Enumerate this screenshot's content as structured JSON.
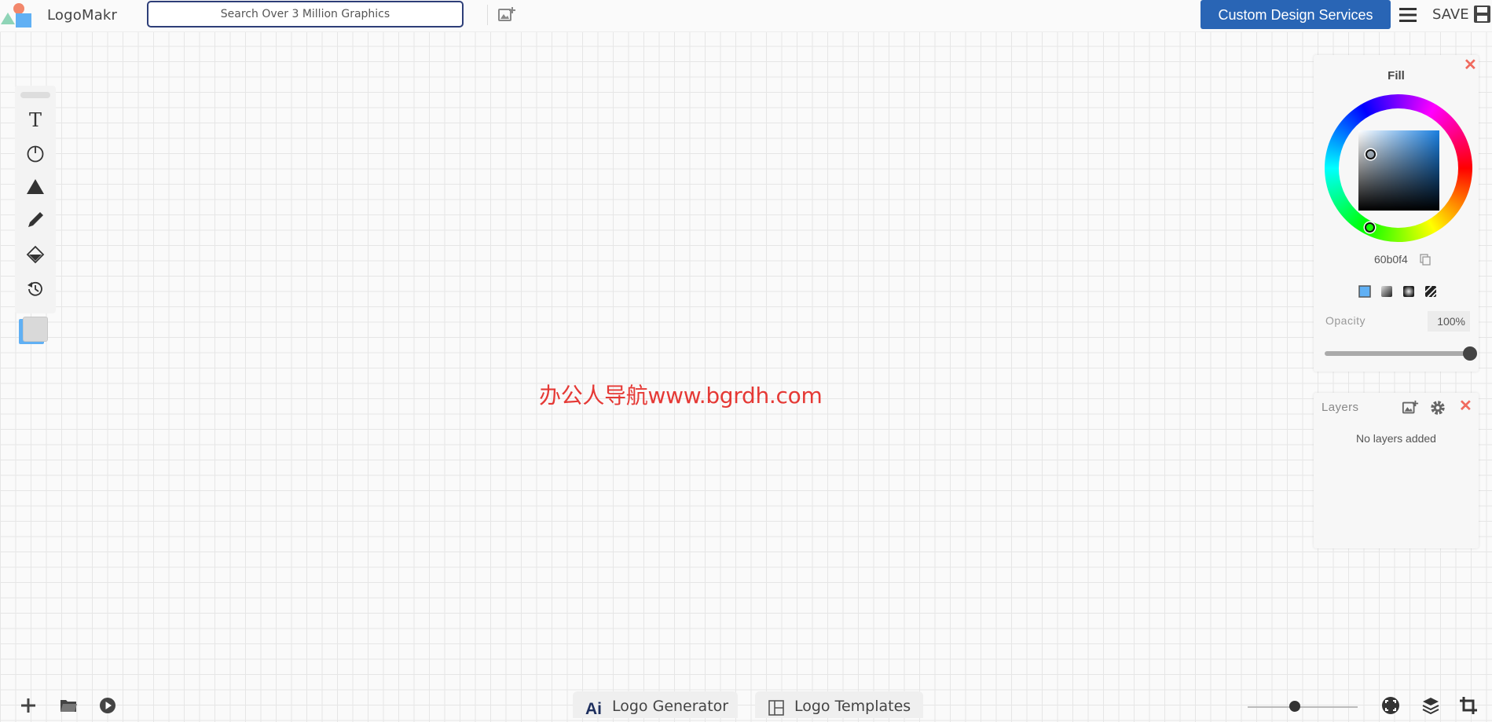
{
  "header": {
    "brand": "LogoMakr",
    "search_placeholder": "Search Over 3 Million Graphics",
    "custom_design_label": "Custom Design Services",
    "save_label": "SAVE"
  },
  "toolbar": {
    "tools": [
      "text-tool",
      "icon-search-tool",
      "shape-tool",
      "pen-tool",
      "fill-tool",
      "history-tool"
    ],
    "current_colors": {
      "front": "#d9d9d9",
      "back": "#60b0f4"
    }
  },
  "fill_panel": {
    "title": "Fill",
    "hex_value": "60b0f4",
    "fill_types": [
      "solid",
      "linear-gradient",
      "radial-gradient",
      "pattern"
    ],
    "opacity_label": "Opacity",
    "opacity_value": "100%",
    "opacity_level": 1.0
  },
  "layers_panel": {
    "title": "Layers",
    "empty_text": "No layers added"
  },
  "watermark": "办公人导航www.bgrdh.com",
  "bottom_bar": {
    "tabs": [
      {
        "label": "Logo Generator",
        "icon": "ai-icon"
      },
      {
        "label": "Logo Templates",
        "icon": "templates-icon"
      }
    ],
    "zoom_level": 0.38
  },
  "colors": {
    "accent": "#2965b5",
    "search_border": "#2d3e78",
    "close": "#f06a5e",
    "watermark": "#e53935"
  }
}
